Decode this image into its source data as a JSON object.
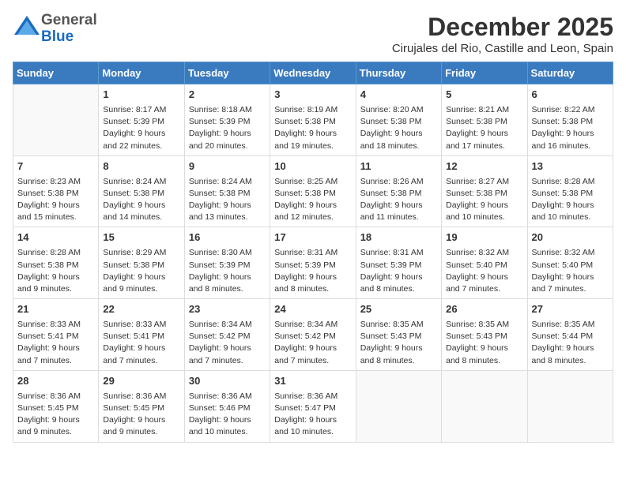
{
  "logo": {
    "general": "General",
    "blue": "Blue"
  },
  "title": "December 2025",
  "subtitle": "Cirujales del Rio, Castille and Leon, Spain",
  "days_of_week": [
    "Sunday",
    "Monday",
    "Tuesday",
    "Wednesday",
    "Thursday",
    "Friday",
    "Saturday"
  ],
  "weeks": [
    [
      {
        "day": "",
        "info": ""
      },
      {
        "day": "1",
        "sunrise": "8:17 AM",
        "sunset": "5:39 PM",
        "daylight": "9 hours and 22 minutes."
      },
      {
        "day": "2",
        "sunrise": "8:18 AM",
        "sunset": "5:39 PM",
        "daylight": "9 hours and 20 minutes."
      },
      {
        "day": "3",
        "sunrise": "8:19 AM",
        "sunset": "5:38 PM",
        "daylight": "9 hours and 19 minutes."
      },
      {
        "day": "4",
        "sunrise": "8:20 AM",
        "sunset": "5:38 PM",
        "daylight": "9 hours and 18 minutes."
      },
      {
        "day": "5",
        "sunrise": "8:21 AM",
        "sunset": "5:38 PM",
        "daylight": "9 hours and 17 minutes."
      },
      {
        "day": "6",
        "sunrise": "8:22 AM",
        "sunset": "5:38 PM",
        "daylight": "9 hours and 16 minutes."
      }
    ],
    [
      {
        "day": "7",
        "sunrise": "8:23 AM",
        "sunset": "5:38 PM",
        "daylight": "9 hours and 15 minutes."
      },
      {
        "day": "8",
        "sunrise": "8:24 AM",
        "sunset": "5:38 PM",
        "daylight": "9 hours and 14 minutes."
      },
      {
        "day": "9",
        "sunrise": "8:24 AM",
        "sunset": "5:38 PM",
        "daylight": "9 hours and 13 minutes."
      },
      {
        "day": "10",
        "sunrise": "8:25 AM",
        "sunset": "5:38 PM",
        "daylight": "9 hours and 12 minutes."
      },
      {
        "day": "11",
        "sunrise": "8:26 AM",
        "sunset": "5:38 PM",
        "daylight": "9 hours and 11 minutes."
      },
      {
        "day": "12",
        "sunrise": "8:27 AM",
        "sunset": "5:38 PM",
        "daylight": "9 hours and 10 minutes."
      },
      {
        "day": "13",
        "sunrise": "8:28 AM",
        "sunset": "5:38 PM",
        "daylight": "9 hours and 10 minutes."
      }
    ],
    [
      {
        "day": "14",
        "sunrise": "8:28 AM",
        "sunset": "5:38 PM",
        "daylight": "9 hours and 9 minutes."
      },
      {
        "day": "15",
        "sunrise": "8:29 AM",
        "sunset": "5:38 PM",
        "daylight": "9 hours and 9 minutes."
      },
      {
        "day": "16",
        "sunrise": "8:30 AM",
        "sunset": "5:39 PM",
        "daylight": "9 hours and 8 minutes."
      },
      {
        "day": "17",
        "sunrise": "8:31 AM",
        "sunset": "5:39 PM",
        "daylight": "9 hours and 8 minutes."
      },
      {
        "day": "18",
        "sunrise": "8:31 AM",
        "sunset": "5:39 PM",
        "daylight": "9 hours and 8 minutes."
      },
      {
        "day": "19",
        "sunrise": "8:32 AM",
        "sunset": "5:40 PM",
        "daylight": "9 hours and 7 minutes."
      },
      {
        "day": "20",
        "sunrise": "8:32 AM",
        "sunset": "5:40 PM",
        "daylight": "9 hours and 7 minutes."
      }
    ],
    [
      {
        "day": "21",
        "sunrise": "8:33 AM",
        "sunset": "5:41 PM",
        "daylight": "9 hours and 7 minutes."
      },
      {
        "day": "22",
        "sunrise": "8:33 AM",
        "sunset": "5:41 PM",
        "daylight": "9 hours and 7 minutes."
      },
      {
        "day": "23",
        "sunrise": "8:34 AM",
        "sunset": "5:42 PM",
        "daylight": "9 hours and 7 minutes."
      },
      {
        "day": "24",
        "sunrise": "8:34 AM",
        "sunset": "5:42 PM",
        "daylight": "9 hours and 7 minutes."
      },
      {
        "day": "25",
        "sunrise": "8:35 AM",
        "sunset": "5:43 PM",
        "daylight": "9 hours and 8 minutes."
      },
      {
        "day": "26",
        "sunrise": "8:35 AM",
        "sunset": "5:43 PM",
        "daylight": "9 hours and 8 minutes."
      },
      {
        "day": "27",
        "sunrise": "8:35 AM",
        "sunset": "5:44 PM",
        "daylight": "9 hours and 8 minutes."
      }
    ],
    [
      {
        "day": "28",
        "sunrise": "8:36 AM",
        "sunset": "5:45 PM",
        "daylight": "9 hours and 9 minutes."
      },
      {
        "day": "29",
        "sunrise": "8:36 AM",
        "sunset": "5:45 PM",
        "daylight": "9 hours and 9 minutes."
      },
      {
        "day": "30",
        "sunrise": "8:36 AM",
        "sunset": "5:46 PM",
        "daylight": "9 hours and 10 minutes."
      },
      {
        "day": "31",
        "sunrise": "8:36 AM",
        "sunset": "5:47 PM",
        "daylight": "9 hours and 10 minutes."
      },
      {
        "day": "",
        "info": ""
      },
      {
        "day": "",
        "info": ""
      },
      {
        "day": "",
        "info": ""
      }
    ]
  ],
  "labels": {
    "sunrise": "Sunrise:",
    "sunset": "Sunset:",
    "daylight": "Daylight:"
  }
}
